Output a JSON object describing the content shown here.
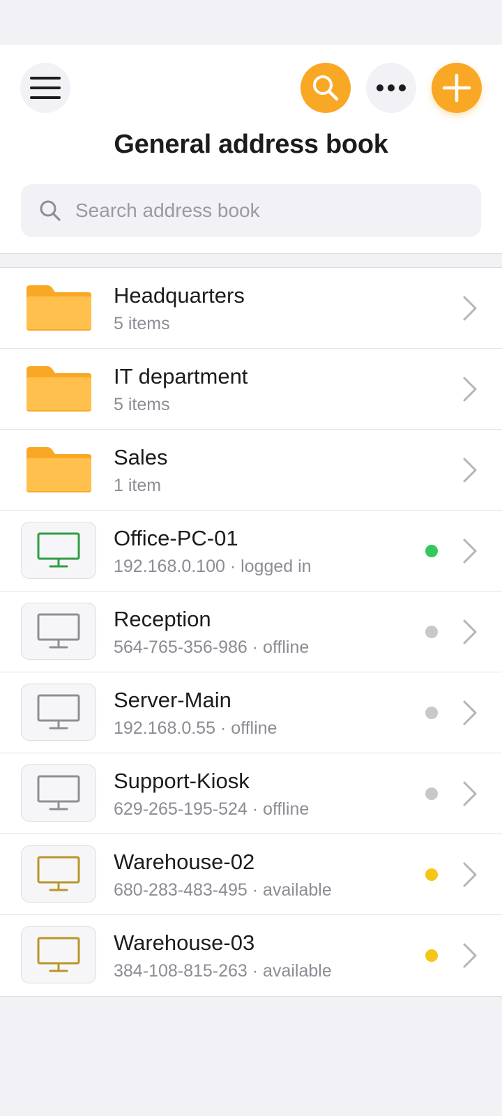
{
  "header": {
    "title": "General address book",
    "search_placeholder": "Search address book"
  },
  "icons": {
    "menu": "hamburger-menu-icon",
    "search": "search-icon",
    "more": "more-horizontal-icon",
    "add": "plus-icon",
    "folder": "folder-icon",
    "device": "monitor-icon",
    "chevron": "chevron-right-icon"
  },
  "colors": {
    "accent": "#f9a826",
    "online": "#34c759",
    "offline": "#c7c7cc",
    "available": "#f5c518"
  },
  "folders": [
    {
      "name": "Headquarters",
      "meta": "5 items"
    },
    {
      "name": "IT department",
      "meta": "5 items"
    },
    {
      "name": "Sales",
      "meta": "1 item"
    }
  ],
  "devices": [
    {
      "name": "Office-PC-01",
      "meta": "192.168.0.100 · logged in",
      "status": "online"
    },
    {
      "name": "Reception",
      "meta": "564-765-356-986 · offline",
      "status": "offline"
    },
    {
      "name": "Server-Main",
      "meta": "192.168.0.55 · offline",
      "status": "offline"
    },
    {
      "name": "Support-Kiosk",
      "meta": "629-265-195-524 · offline",
      "status": "offline"
    },
    {
      "name": "Warehouse-02",
      "meta": "680-283-483-495 · available",
      "status": "available"
    },
    {
      "name": "Warehouse-03",
      "meta": "384-108-815-263 · available",
      "status": "available"
    }
  ]
}
